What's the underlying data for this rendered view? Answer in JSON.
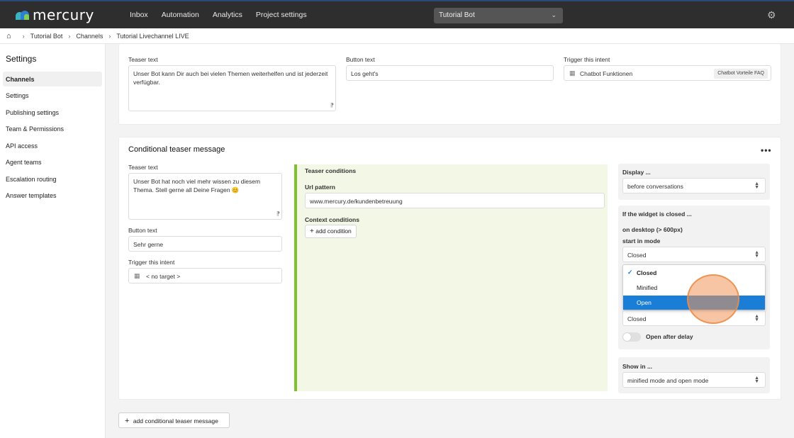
{
  "app": {
    "logo_text": "mercury"
  },
  "topnav": [
    "Inbox",
    "Automation",
    "Analytics",
    "Project settings"
  ],
  "bot_selector": {
    "value": "Tutorial Bot"
  },
  "breadcrumb": [
    "Tutorial Bot",
    "Channels",
    "Tutorial Livechannel LIVE"
  ],
  "sidebar": {
    "title": "Settings",
    "items": [
      "Channels",
      "Settings",
      "Publishing settings",
      "Team & Permissions",
      "API access",
      "Agent teams",
      "Escalation routing",
      "Answer templates"
    ]
  },
  "teaser": {
    "teaser_text_label": "Teaser text",
    "teaser_text_value": "Unser Bot kann Dir auch bei vielen Themen weiterhelfen und ist jederzeit  verfügbar.",
    "button_text_label": "Button text",
    "button_text_value": "Los geht's",
    "trigger_label": "Trigger this intent",
    "trigger_value": "Chatbot Funktionen",
    "trigger_badge": "Chatbot Vorteile FAQ"
  },
  "conditional": {
    "title": "Conditional teaser message",
    "more": "•••",
    "teaser_text_label": "Teaser text",
    "teaser_text_value": "Unser Bot hat noch viel mehr wissen zu diesem Thema. Stell gerne all Deine Fragen 😊",
    "button_text_label": "Button text",
    "button_text_value": "Sehr gerne",
    "trigger_label": "Trigger this intent",
    "trigger_value": "< no target >",
    "conditions_title": "Teaser conditions",
    "url_pattern_label": "Url pattern",
    "url_pattern_value": "www.mercury.de/kundenbetreuung",
    "context_label": "Context conditions",
    "add_condition": "add condition",
    "display_label": "Display ...",
    "display_value": "before conversations",
    "widget_closed_label": "If the widget is closed ...",
    "desktop_label": "on desktop (> 600px)",
    "start_mode_label": "start in mode",
    "start_mode_value": "Closed",
    "mode_options": [
      "Closed",
      "Minified",
      "Open"
    ],
    "mode_selected": "Closed",
    "mode_highlighted": "Open",
    "second_mode_value": "Closed",
    "open_after_delay_label": "Open after delay",
    "open_after_delay_on": false,
    "show_in_label": "Show in ...",
    "show_in_value": "minified mode and open mode"
  },
  "add_conditional_button": "add conditional teaser message",
  "colors": {
    "accent": "#1a7ed6",
    "green_border": "#7cc22a",
    "topbar": "#2e2e2e"
  }
}
